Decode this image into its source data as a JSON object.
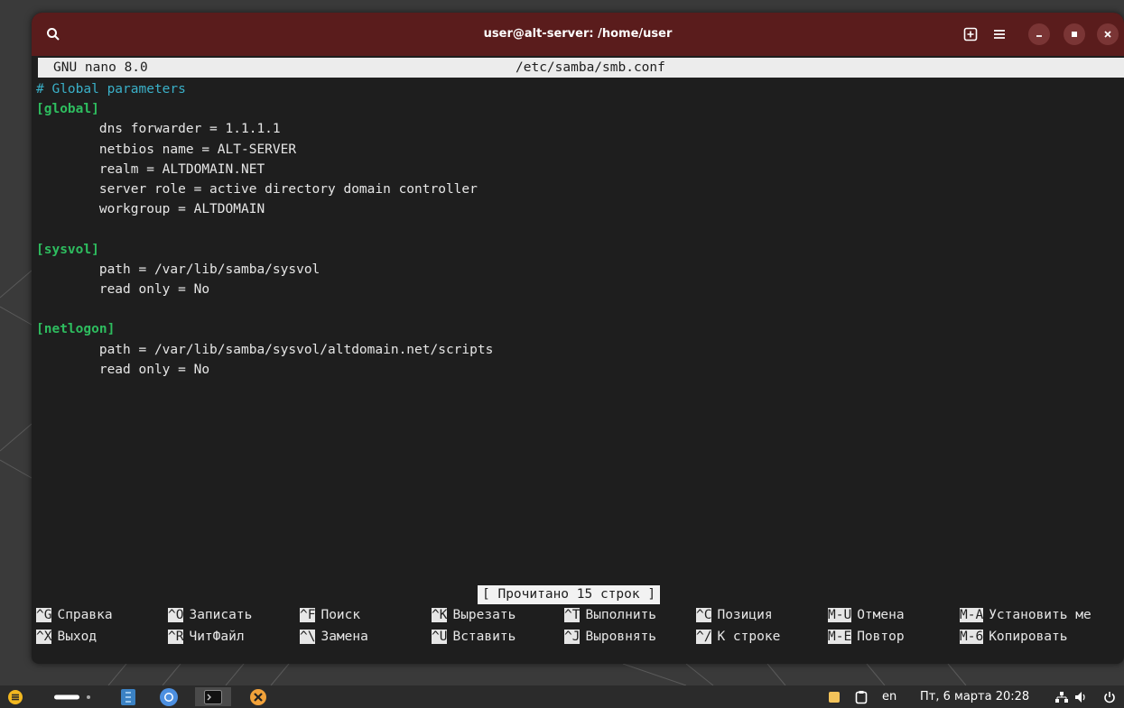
{
  "window": {
    "title": "user@alt-server: /home/user",
    "titlebar_color": "#5a1c1c"
  },
  "nano": {
    "version": "GNU nano 8.0",
    "filename": "/etc/samba/smb.conf",
    "lines": [
      {
        "text": "# Global parameters",
        "kind": "comment"
      },
      {
        "text": "[global]",
        "kind": "section"
      },
      {
        "text": "\tdns forwarder = 1.1.1.1",
        "kind": "kv"
      },
      {
        "text": "\tnetbios name = ALT-SERVER",
        "kind": "kv"
      },
      {
        "text": "\trealm = ALTDOMAIN.NET",
        "kind": "kv"
      },
      {
        "text": "\tserver role = active directory domain controller",
        "kind": "kv"
      },
      {
        "text": "\tworkgroup = ALTDOMAIN",
        "kind": "kv"
      },
      {
        "text": "",
        "kind": "kv"
      },
      {
        "text": "[sysvol]",
        "kind": "section"
      },
      {
        "text": "\tpath = /var/lib/samba/sysvol",
        "kind": "kv"
      },
      {
        "text": "\tread only = No",
        "kind": "kv"
      },
      {
        "text": "",
        "kind": "kv"
      },
      {
        "text": "[netlogon]",
        "kind": "section"
      },
      {
        "text": "\tpath = /var/lib/samba/sysvol/altdomain.net/scripts",
        "kind": "kv"
      },
      {
        "text": "\tread only = No",
        "kind": "kv"
      }
    ],
    "status": "[ Прочитано 15 строк ]",
    "shortcuts_row1": [
      {
        "key": "^G",
        "label": "Справка"
      },
      {
        "key": "^O",
        "label": "Записать"
      },
      {
        "key": "^F",
        "label": "Поиск"
      },
      {
        "key": "^K",
        "label": "Вырезать"
      },
      {
        "key": "^T",
        "label": "Выполнить"
      },
      {
        "key": "^C",
        "label": "Позиция"
      },
      {
        "key": "M-U",
        "label": "Отмена"
      },
      {
        "key": "M-A",
        "label": "Установить ме"
      }
    ],
    "shortcuts_row2": [
      {
        "key": "^X",
        "label": "Выход"
      },
      {
        "key": "^R",
        "label": "ЧитФайл"
      },
      {
        "key": "^\\",
        "label": "Замена"
      },
      {
        "key": "^U",
        "label": "Вставить"
      },
      {
        "key": "^J",
        "label": "Выровнять"
      },
      {
        "key": "^/",
        "label": "К строке"
      },
      {
        "key": "M-E",
        "label": "Повтор"
      },
      {
        "key": "M-6",
        "label": "Копировать"
      }
    ],
    "comment_color": "#3ab0c8",
    "section_color": "#2ebd5f"
  },
  "taskbar": {
    "apps": [
      "menu-icon",
      "workspace-switcher-icon",
      "file-manager-icon",
      "chromium-icon",
      "terminal-icon",
      "settings-icon"
    ],
    "keyboard_layout": "en",
    "datetime": "Пт, 6 марта 20:28"
  }
}
